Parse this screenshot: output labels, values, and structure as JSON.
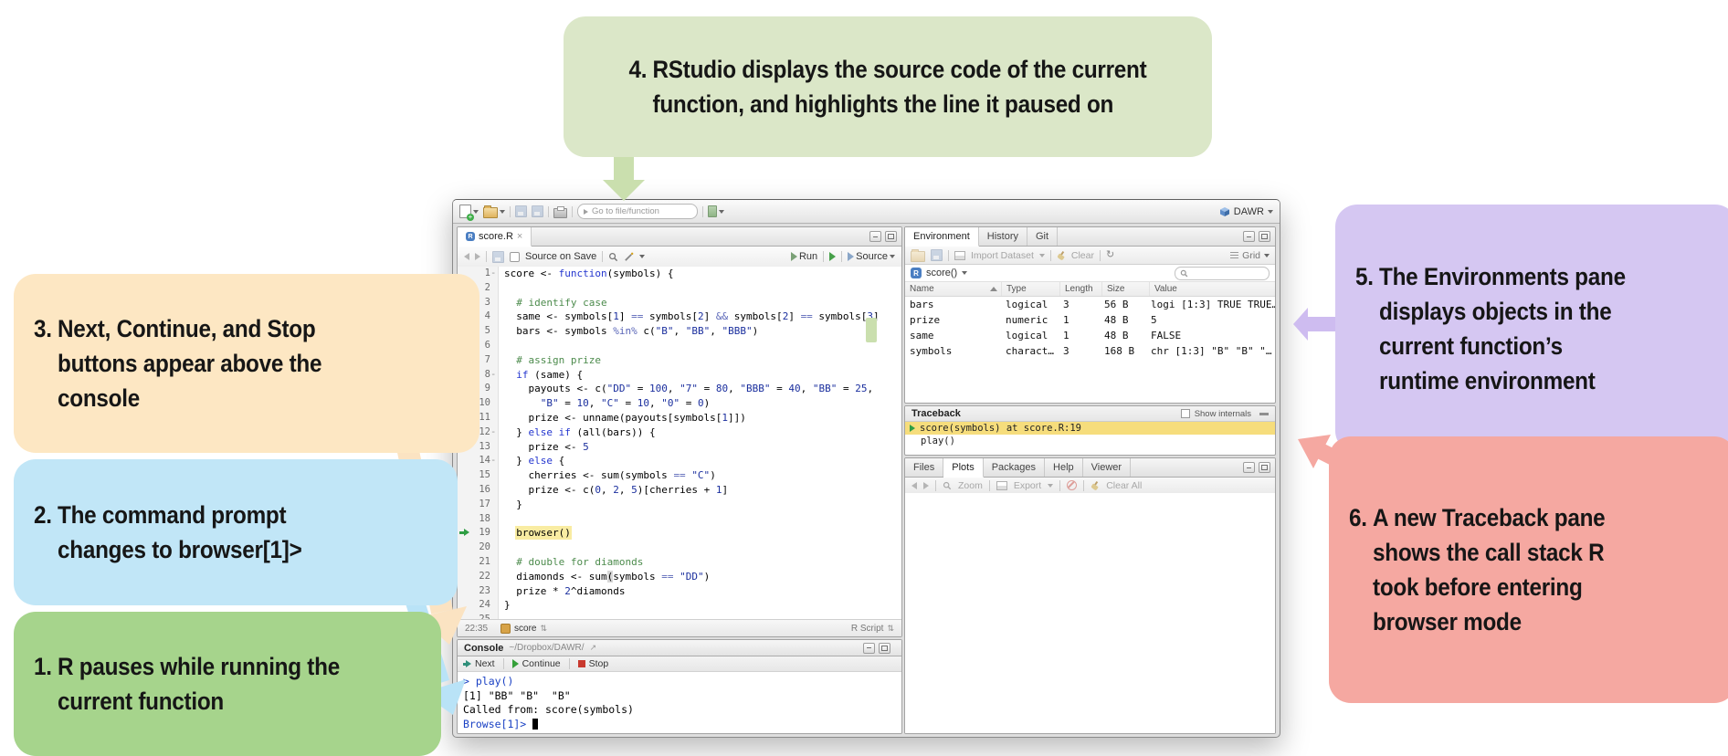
{
  "colors": {
    "bubble_green": "#a6d48c",
    "bubble_blue": "#c1e6f7",
    "bubble_orange": "#fde7c3",
    "bubble_pale_green": "#dbe7c8",
    "bubble_purple": "#d5c7f2",
    "bubble_red": "#f5a8a1",
    "arrow_green": "#cadfae",
    "arrow_orange": "#fbe3c2",
    "arrow_blue": "#b9e3f7",
    "arrow_purple": "#cebcf0",
    "arrow_red": "#f5a8a1",
    "syntax_keyword": "#2335cf",
    "syntax_string": "#1b2f9e",
    "syntax_operator": "#5a66b8",
    "syntax_comment": "#4c8b4c",
    "highlight_yellow": "#f9eca2",
    "traceback_yellow": "#f6dd7c",
    "debug_green": "#2f9e44",
    "prompt_blue": "#1a41c4"
  },
  "callouts": [
    {
      "num": "1.",
      "text": "R pauses while running the\ncurrent function"
    },
    {
      "num": "2.",
      "text": "The command prompt\nchanges to browser[1]>"
    },
    {
      "num": "3.",
      "text": "Next, Continue, and Stop\nbuttons appear above the\nconsole"
    },
    {
      "num": "4.",
      "text": "RStudio displays the source code of the current\nfunction, and highlights the line it paused on"
    },
    {
      "num": "5.",
      "text": "The Environments pane\ndisplays objects in the\ncurrent function’s\nruntime environment"
    },
    {
      "num": "6.",
      "text": "A new Traceback pane\nshows the call stack R\ntook before entering\nbrowser mode"
    }
  ],
  "window": {
    "toolbar": {
      "goto_placeholder": "Go to file/function",
      "project": "DAWR"
    },
    "source_pane": {
      "tab": "score.R",
      "tab_close": "×",
      "source_on_save": "Source on Save",
      "run_label": "Run",
      "source_label": "Source",
      "status_position": "22:35",
      "status_scope": "score",
      "status_type": "R Script",
      "code_lines": [
        {
          "n": "1",
          "fold": true,
          "t": [
            [
              "pl",
              "score <- "
            ],
            [
              "kw",
              "function"
            ],
            [
              "pl",
              "(symbols) {"
            ]
          ]
        },
        {
          "n": "2",
          "t": []
        },
        {
          "n": "3",
          "t": [
            [
              "cm",
              "  # identify case"
            ]
          ]
        },
        {
          "n": "4",
          "t": [
            [
              "pl",
              "  same <- symbols["
            ],
            [
              "st",
              "1"
            ],
            [
              "pl",
              "] "
            ],
            [
              "op",
              "=="
            ],
            [
              "pl",
              " symbols["
            ],
            [
              "st",
              "2"
            ],
            [
              "pl",
              "] "
            ],
            [
              "op",
              "&&"
            ],
            [
              "pl",
              " symbols["
            ],
            [
              "st",
              "2"
            ],
            [
              "pl",
              "] "
            ],
            [
              "op",
              "=="
            ],
            [
              "pl",
              " symbols["
            ],
            [
              "st",
              "3"
            ],
            [
              "pl",
              "]"
            ]
          ]
        },
        {
          "n": "5",
          "t": [
            [
              "pl",
              "  bars <- symbols "
            ],
            [
              "op",
              "%in%"
            ],
            [
              "pl",
              " c("
            ],
            [
              "st",
              "\"B\""
            ],
            [
              "pl",
              ", "
            ],
            [
              "st",
              "\"BB\""
            ],
            [
              "pl",
              ", "
            ],
            [
              "st",
              "\"BBB\""
            ],
            [
              "pl",
              ")"
            ]
          ]
        },
        {
          "n": "6",
          "t": []
        },
        {
          "n": "7",
          "t": [
            [
              "cm",
              "  # assign prize"
            ]
          ]
        },
        {
          "n": "8",
          "fold": true,
          "t": [
            [
              "pl",
              "  "
            ],
            [
              "kw",
              "if"
            ],
            [
              "pl",
              " (same) {"
            ]
          ]
        },
        {
          "n": "9",
          "t": [
            [
              "pl",
              "    payouts <- c("
            ],
            [
              "st",
              "\"DD\""
            ],
            [
              "pl",
              " = "
            ],
            [
              "st",
              "100"
            ],
            [
              "pl",
              ", "
            ],
            [
              "st",
              "\"7\""
            ],
            [
              "pl",
              " = "
            ],
            [
              "st",
              "80"
            ],
            [
              "pl",
              ", "
            ],
            [
              "st",
              "\"BBB\""
            ],
            [
              "pl",
              " = "
            ],
            [
              "st",
              "40"
            ],
            [
              "pl",
              ", "
            ],
            [
              "st",
              "\"BB\""
            ],
            [
              "pl",
              " = "
            ],
            [
              "st",
              "25"
            ],
            [
              "pl",
              ","
            ]
          ]
        },
        {
          "n": "10",
          "t": [
            [
              "pl",
              "      "
            ],
            [
              "st",
              "\"B\""
            ],
            [
              "pl",
              " = "
            ],
            [
              "st",
              "10"
            ],
            [
              "pl",
              ", "
            ],
            [
              "st",
              "\"C\""
            ],
            [
              "pl",
              " = "
            ],
            [
              "st",
              "10"
            ],
            [
              "pl",
              ", "
            ],
            [
              "st",
              "\"0\""
            ],
            [
              "pl",
              " = "
            ],
            [
              "st",
              "0"
            ],
            [
              "pl",
              ")"
            ]
          ]
        },
        {
          "n": "11",
          "t": [
            [
              "pl",
              "    prize <- unname(payouts[symbols["
            ],
            [
              "st",
              "1"
            ],
            [
              "pl",
              "]])"
            ]
          ]
        },
        {
          "n": "12",
          "fold": true,
          "t": [
            [
              "pl",
              "  } "
            ],
            [
              "kw",
              "else"
            ],
            [
              "pl",
              " "
            ],
            [
              "kw",
              "if"
            ],
            [
              "pl",
              " (all(bars)) {"
            ]
          ]
        },
        {
          "n": "13",
          "t": [
            [
              "pl",
              "    prize <- "
            ],
            [
              "st",
              "5"
            ]
          ]
        },
        {
          "n": "14",
          "fold": true,
          "t": [
            [
              "pl",
              "  } "
            ],
            [
              "kw",
              "else"
            ],
            [
              "pl",
              " {"
            ]
          ]
        },
        {
          "n": "15",
          "t": [
            [
              "pl",
              "    cherries <- sum(symbols "
            ],
            [
              "op",
              "=="
            ],
            [
              "pl",
              " "
            ],
            [
              "st",
              "\"C\""
            ],
            [
              "pl",
              ")"
            ]
          ]
        },
        {
          "n": "16",
          "t": [
            [
              "pl",
              "    prize <- c("
            ],
            [
              "st",
              "0"
            ],
            [
              "pl",
              ", "
            ],
            [
              "st",
              "2"
            ],
            [
              "pl",
              ", "
            ],
            [
              "st",
              "5"
            ],
            [
              "pl",
              ")[cherries + "
            ],
            [
              "st",
              "1"
            ],
            [
              "pl",
              "]"
            ]
          ]
        },
        {
          "n": "17",
          "t": [
            [
              "pl",
              "  }"
            ]
          ]
        },
        {
          "n": "18",
          "t": []
        },
        {
          "n": "19",
          "marker": true,
          "t": [
            [
              "pl",
              "  "
            ],
            [
              "hl",
              "browser()"
            ]
          ]
        },
        {
          "n": "20",
          "t": []
        },
        {
          "n": "21",
          "t": [
            [
              "cm",
              "  # double for diamonds"
            ]
          ]
        },
        {
          "n": "22",
          "t": [
            [
              "pl",
              "  diamonds <- sum"
            ],
            [
              "br",
              "("
            ],
            [
              "pl",
              "symbols "
            ],
            [
              "op",
              "=="
            ],
            [
              "pl",
              " "
            ],
            [
              "st",
              "\"DD\""
            ],
            [
              "pl",
              ")"
            ]
          ]
        },
        {
          "n": "23",
          "t": [
            [
              "pl",
              "  prize * "
            ],
            [
              "st",
              "2"
            ],
            [
              "pl",
              "^diamonds"
            ]
          ]
        },
        {
          "n": "24",
          "t": [
            [
              "pl",
              "}"
            ]
          ]
        },
        {
          "n": "25",
          "t": []
        }
      ]
    },
    "console": {
      "title": "Console",
      "path": "~/Dropbox/DAWR/",
      "next_label": "Next",
      "continue_label": "Continue",
      "stop_label": "Stop",
      "lines": [
        {
          "type": "input",
          "text": "> play()"
        },
        {
          "type": "output",
          "text": "[1] \"BB\" \"B\"  \"B\""
        },
        {
          "type": "output",
          "text": "Called from: score(symbols)"
        },
        {
          "type": "prompt",
          "text": "Browse[1]> "
        }
      ]
    },
    "environment": {
      "tabs": [
        "Environment",
        "History",
        "Git"
      ],
      "import_label": "Import Dataset",
      "clear_label": "Clear",
      "grid_label": "Grid",
      "scope": "score()",
      "headers": [
        "Name",
        "Type",
        "Length",
        "Size",
        "Value"
      ],
      "rows": [
        [
          "bars",
          "logical",
          "3",
          "56 B",
          "logi [1:3] TRUE TRUE…"
        ],
        [
          "prize",
          "numeric",
          "1",
          "48 B",
          "5"
        ],
        [
          "same",
          "logical",
          "1",
          "48 B",
          "FALSE"
        ],
        [
          "symbols",
          "charact…",
          "3",
          "168 B",
          "chr [1:3] \"B\" \"B\" \"…"
        ]
      ]
    },
    "traceback": {
      "title": "Traceback",
      "show_internals": "Show internals",
      "frames": [
        {
          "text": "score(symbols) at score.R:19",
          "active": true
        },
        {
          "text": "play()",
          "active": false
        }
      ]
    },
    "files": {
      "tabs": [
        "Files",
        "Plots",
        "Packages",
        "Help",
        "Viewer"
      ],
      "selected_tab": "Plots",
      "zoom_label": "Zoom",
      "export_label": "Export",
      "clear_all_label": "Clear All"
    }
  }
}
